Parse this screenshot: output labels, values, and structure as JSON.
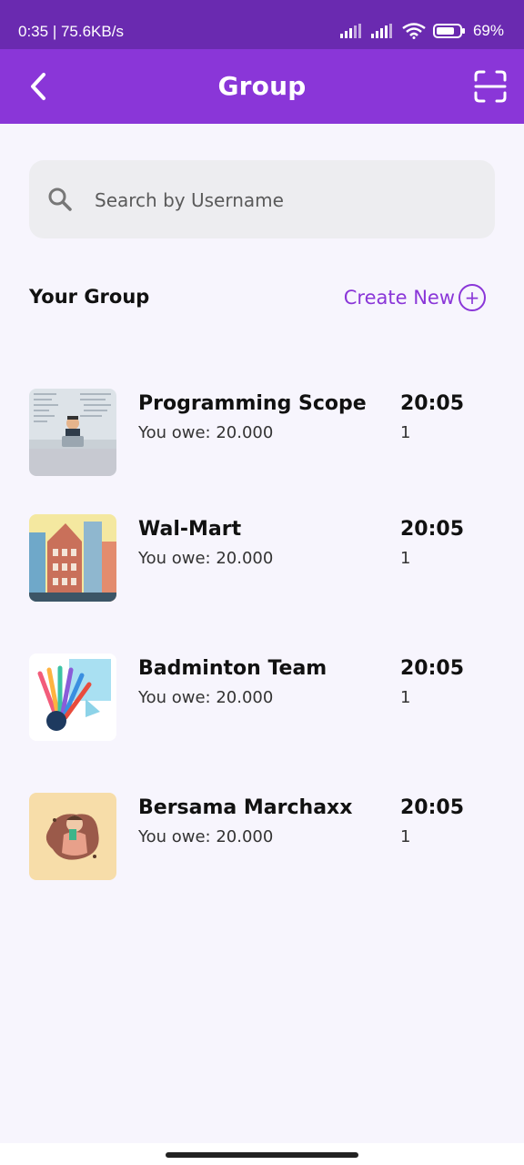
{
  "status_bar": {
    "time": "0:35",
    "speed": "75.6KB/s",
    "battery": "69%"
  },
  "header": {
    "title": "Group"
  },
  "search": {
    "placeholder": "Search by Username"
  },
  "section": {
    "title": "Your Group",
    "create_label": "Create New",
    "create_symbol": "+"
  },
  "groups": [
    {
      "name": "Programming Scope",
      "owe": "You owe: 20.000",
      "time": "20:05",
      "count": "1"
    },
    {
      "name": "Wal-Mart",
      "owe": "You owe: 20.000",
      "time": "20:05",
      "count": "1"
    },
    {
      "name": "Badminton Team",
      "owe": "You owe: 20.000",
      "time": "20:05",
      "count": "1"
    },
    {
      "name": "Bersama Marchaxx",
      "owe": "You owe: 20.000",
      "time": "20:05",
      "count": "1"
    }
  ],
  "colors": {
    "primary": "#8A36D8",
    "status": "#6A2AB0",
    "background": "#F7F5FD"
  }
}
